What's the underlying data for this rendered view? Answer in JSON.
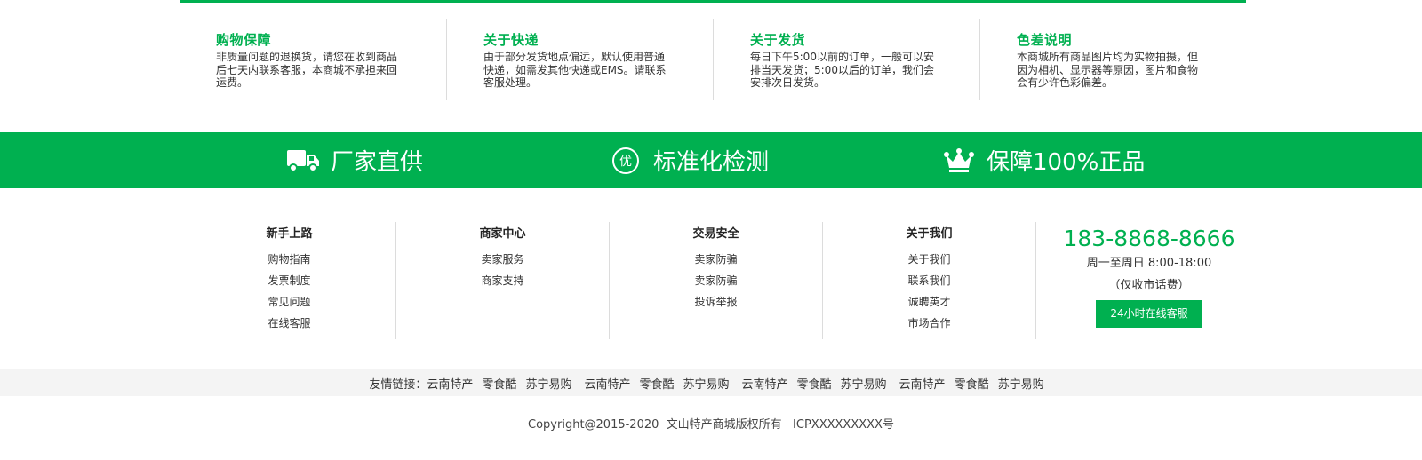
{
  "guarantees": [
    {
      "title": "购物保障",
      "text": "非质量问题的退换货，请您在收到商品后七天内联系客服，本商城不承担来回运费。"
    },
    {
      "title": "关于快递",
      "text": "由于部分发货地点偏远，默认使用普通快递，如需发其他快递或EMS。请联系客服处理。"
    },
    {
      "title": "关于发货",
      "text": "每日下午5:00以前的订单，一般可以安排当天发货；5:00以后的订单，我们会安排次日发货。"
    },
    {
      "title": "色差说明",
      "text": "本商城所有商品图片均为实物拍摄，但因为相机、显示器等原因，图片和食物会有少许色彩偏差。"
    }
  ],
  "banner": [
    {
      "icon": "truck-icon",
      "label": "厂家直供"
    },
    {
      "icon": "quality-badge-icon",
      "label": "标准化检测"
    },
    {
      "icon": "crown-icon",
      "label": "保障100%正品"
    }
  ],
  "footer_nav": [
    {
      "title": "新手上路",
      "items": [
        "购物指南",
        "发票制度",
        "常见问题",
        "在线客服"
      ]
    },
    {
      "title": "商家中心",
      "items": [
        "卖家服务",
        "商家支持"
      ]
    },
    {
      "title": "交易安全",
      "items": [
        "卖家防骗",
        "卖家防骗",
        "投诉举报"
      ]
    },
    {
      "title": "关于我们",
      "items": [
        "关于我们",
        "联系我们",
        "诚聘英才",
        "市场合作"
      ]
    }
  ],
  "contact": {
    "phone": "183-8868-8666",
    "hours": "周一至周日 8:00-18:00",
    "note": "（仅收市话费）",
    "button": "24小时在线客服"
  },
  "friend_links": {
    "label": "友情链接：",
    "links": [
      "云南特产",
      "零食酷",
      "苏宁易购",
      "云南特产",
      "零食酷",
      "苏宁易购",
      "云南特产",
      "零食酷",
      "苏宁易购",
      "云南特产",
      "零食酷",
      "苏宁易购"
    ]
  },
  "copyright": "Copyright@2015-2020  文山特产商城版权所有   ICPXXXXXXXXX号",
  "colors": {
    "accent": "#00b050",
    "link_bar_bg": "#f4f4f4",
    "divider": "#dcdcdc"
  }
}
